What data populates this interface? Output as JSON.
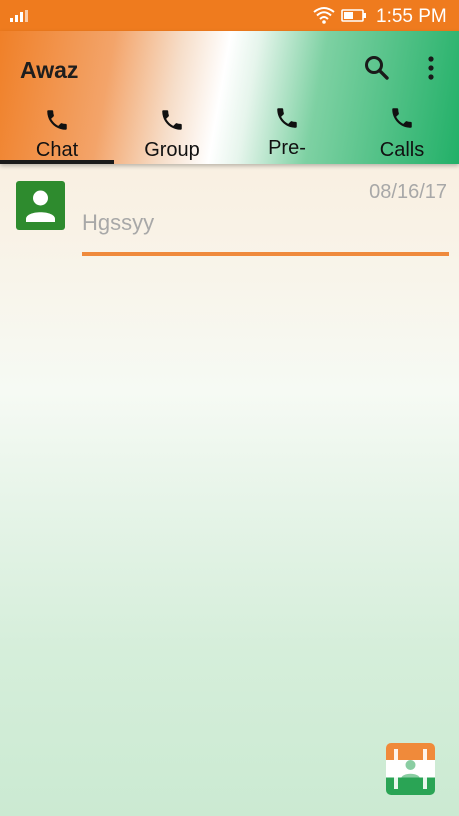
{
  "status_bar": {
    "time": "1:55 PM",
    "icons": [
      "signal-icon",
      "wifi-icon",
      "battery-icon"
    ]
  },
  "toolbar": {
    "title": "Awaz",
    "actions": [
      "search-icon",
      "more-vert-icon"
    ]
  },
  "tabs": [
    {
      "label": "Chat",
      "icon": "phone-icon",
      "selected": true
    },
    {
      "label": "Group",
      "icon": "phone-icon",
      "selected": false
    },
    {
      "label": "Pre-",
      "icon": "phone-icon",
      "selected": false
    },
    {
      "label": "Calls",
      "icon": "phone-icon",
      "selected": false
    }
  ],
  "chats": [
    {
      "name": "Hgssyy",
      "date": "08/16/17",
      "avatar": "person-icon"
    }
  ],
  "fab": {
    "icon": "contacts-icon"
  },
  "colors": {
    "status_bar": "#ef7b1e",
    "accent_orange": "#ef8a3c",
    "accent_green": "#22b068",
    "avatar_green": "#2e8b2e"
  }
}
